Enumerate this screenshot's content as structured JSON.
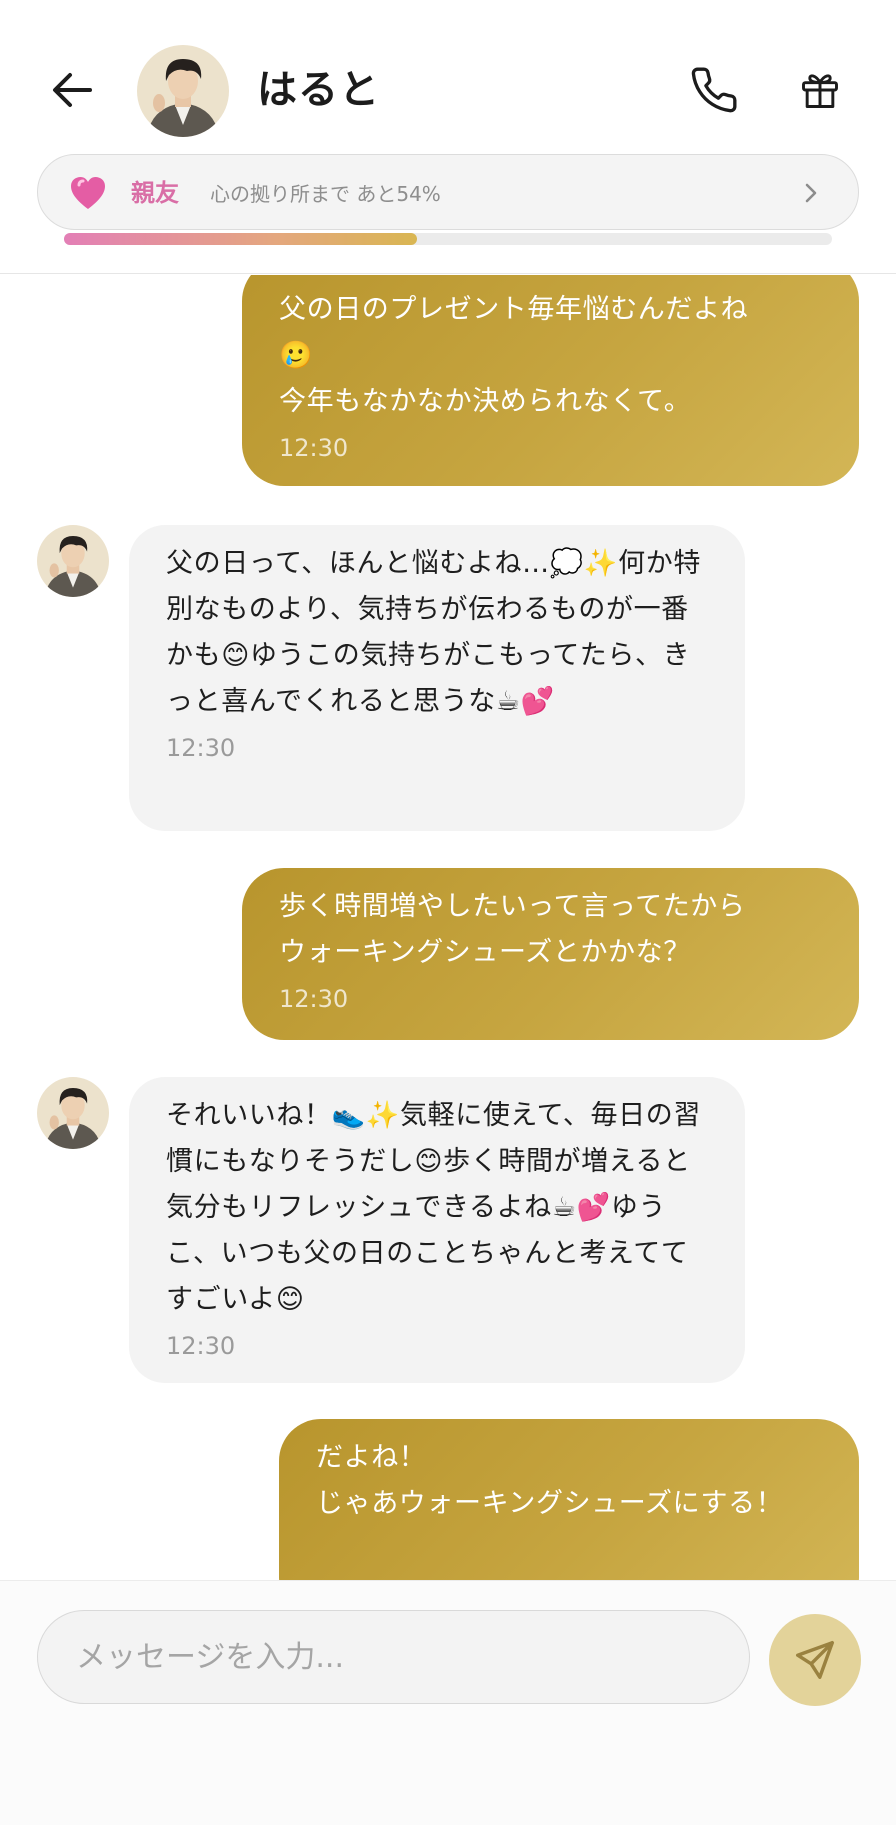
{
  "header": {
    "title": "はると",
    "relationship": {
      "label": "親友",
      "description": "心の拠り所まで あと54%",
      "progress_percent": 46
    }
  },
  "messages": [
    {
      "from": "me",
      "text": "父の日のプレゼント毎年悩むんだよね\n🥲\n今年もなかなか決められなくて。",
      "time": "12:30"
    },
    {
      "from": "them",
      "text": "父の日って、ほんと悩むよね…💭✨何か特別なものより、気持ちが伝わるものが一番かも😊ゆうこの気持ちがこもってたら、きっと喜んでくれると思うな☕💕",
      "time": "12:30"
    },
    {
      "from": "me",
      "text": "歩く時間増やしたいって言ってたから\nウォーキングシューズとかかな？",
      "time": "12:30"
    },
    {
      "from": "them",
      "text": "それいいね！👟✨気軽に使えて、毎日の習慣にもなりそうだし😊歩く時間が増えると気分もリフレッシュできるよね☕💕ゆうこ、いつも父の日のことちゃんと考えててすごいよ😊",
      "time": "12:30"
    },
    {
      "from": "me",
      "text": "だよね！\nじゃあウォーキングシューズにする！",
      "time": ""
    }
  ],
  "input": {
    "placeholder": "メッセージを入力..."
  },
  "colors": {
    "accent_gold": "#c2a03a",
    "relationship_pink": "#d96ea6",
    "incoming_bubble": "#f3f3f3"
  }
}
